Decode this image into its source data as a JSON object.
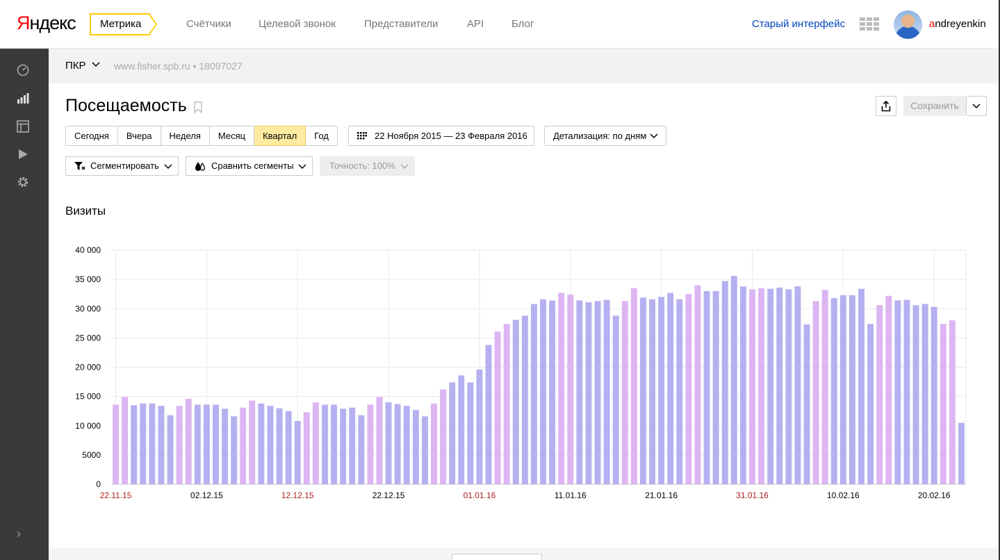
{
  "header": {
    "logo": {
      "first": "Я",
      "rest": "ндекс"
    },
    "product": "Метрика",
    "nav": [
      "Счётчики",
      "Целевой звонок",
      "Представители",
      "API",
      "Блог"
    ],
    "old_interface": "Старый интерфейс",
    "user": {
      "first": "a",
      "rest": "ndreyenkin"
    }
  },
  "counter": {
    "name": "ПКР",
    "site": "www.fisher.spb.ru  •  18097027"
  },
  "report": {
    "title": "Посещаемость",
    "save": "Сохранить",
    "periods": [
      "Сегодня",
      "Вчера",
      "Неделя",
      "Месяц",
      "Квартал",
      "Год"
    ],
    "active_period": "Квартал",
    "date_range": "22 Ноября 2015 — 23 Февраля 2016",
    "detail": "Детализация: по дням",
    "segment": "Сегментировать",
    "compare": "Сравнить сегменты",
    "accuracy": "Точность: 100%"
  },
  "chart_title": "Визиты",
  "colors": {
    "weekday_bar": "#b5b0f0",
    "weekend_bar": "#dcb5f2",
    "weekend_label": "#b02020",
    "accent": "#ffcc00"
  },
  "chart_data": {
    "type": "bar",
    "title": "Визиты",
    "ylim": [
      0,
      40000
    ],
    "yticks": [
      "0",
      "5000",
      "10 000",
      "15 000",
      "20 000",
      "25 000",
      "30 000",
      "35 000",
      "40 000"
    ],
    "xtick_labels": [
      "22.11.15",
      "02.12.15",
      "12.12.15",
      "22.12.15",
      "01.01.16",
      "11.01.16",
      "21.01.16",
      "31.01.16",
      "10.02.16",
      "20.02.16"
    ],
    "xtick_weekend": [
      true,
      false,
      true,
      false,
      true,
      false,
      false,
      true,
      false,
      false
    ],
    "start_weekday": 6,
    "values": [
      13600,
      14900,
      13500,
      13800,
      13800,
      13400,
      11800,
      13400,
      14600,
      13600,
      13600,
      13600,
      12900,
      11600,
      13100,
      14300,
      13800,
      13400,
      13000,
      12500,
      10800,
      12300,
      14000,
      13600,
      13600,
      12900,
      13100,
      11800,
      13600,
      14900,
      14000,
      13700,
      13400,
      12700,
      11600,
      13800,
      16200,
      17400,
      18600,
      17400,
      19600,
      23800,
      26100,
      27400,
      28100,
      28800,
      30800,
      31600,
      31400,
      32700,
      32400,
      31400,
      31100,
      31300,
      31500,
      28800,
      31300,
      33500,
      31900,
      31600,
      32000,
      32700,
      31600,
      32500,
      34000,
      33000,
      33000,
      34700,
      35600,
      33800,
      33300,
      33500,
      33400,
      33600,
      33300,
      33800,
      27300,
      31300,
      33200,
      31800,
      32300,
      32300,
      33400,
      27400,
      30600,
      32200,
      31400,
      31500,
      30600,
      30800,
      30300,
      27400,
      28000,
      10500
    ]
  }
}
